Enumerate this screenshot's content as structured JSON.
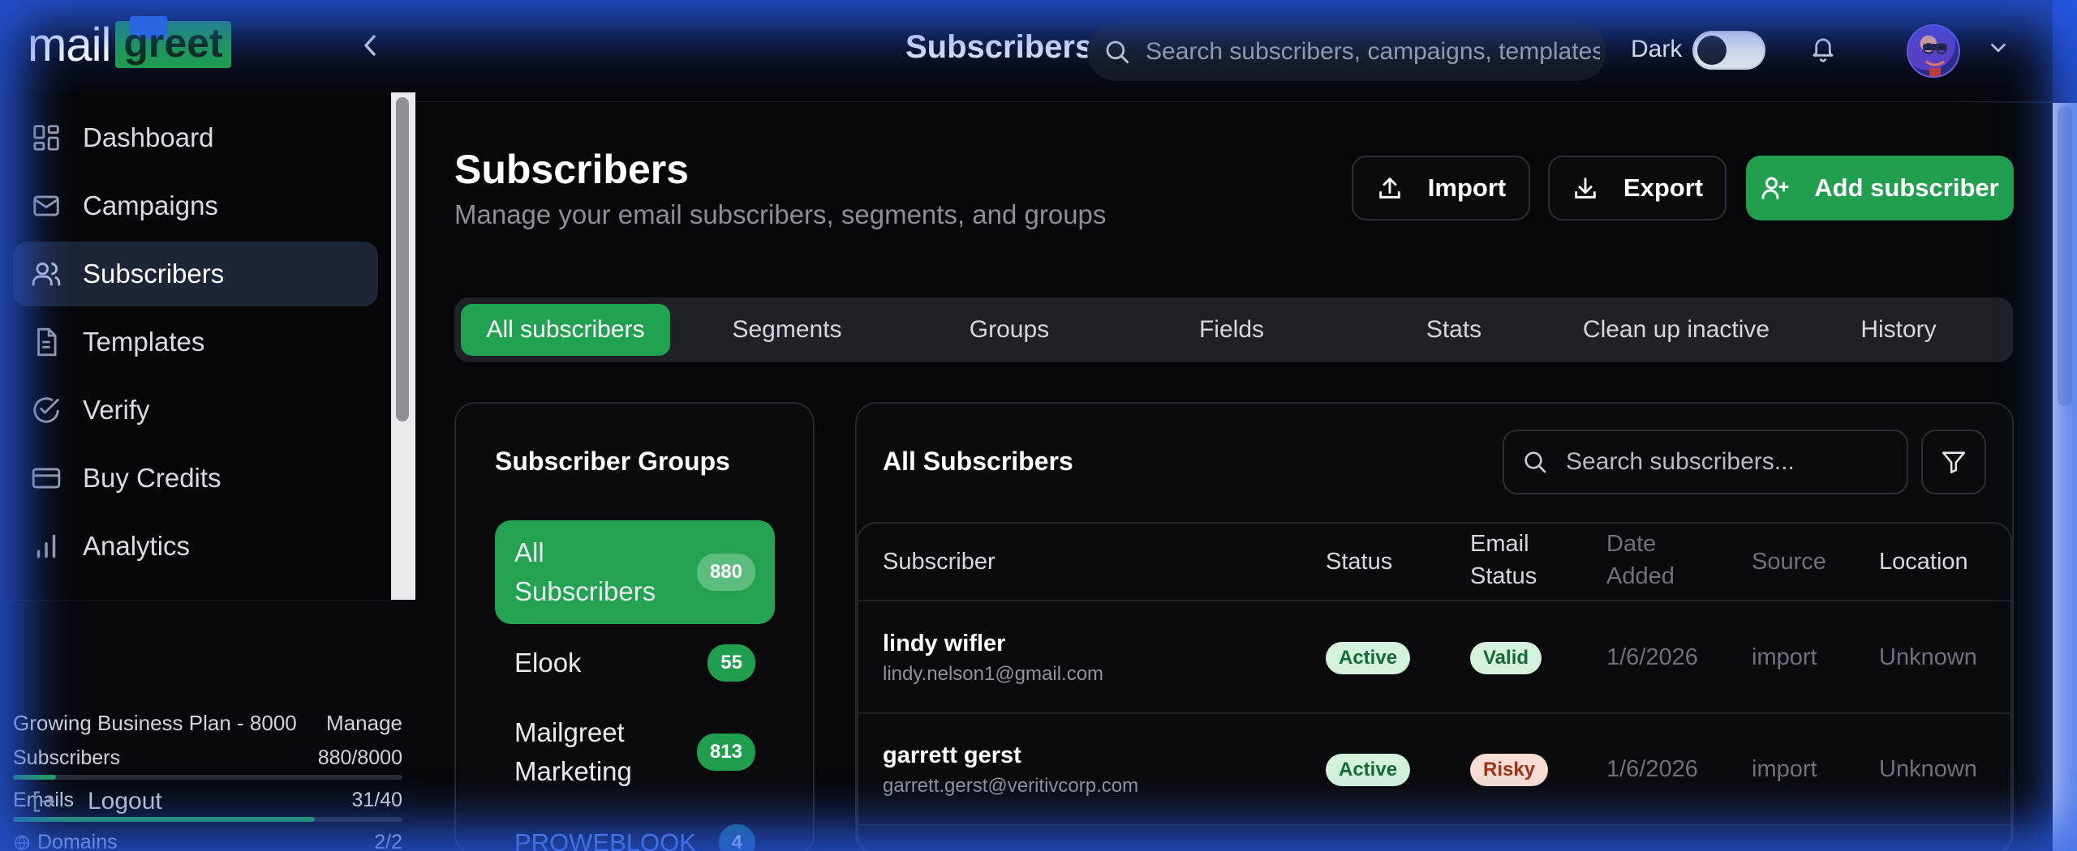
{
  "header": {
    "logo_mail": "mail",
    "logo_greet": "greet",
    "title": "Subscribers",
    "search_placeholder": "Search subscribers, campaigns, templates...",
    "dark_label": "Dark"
  },
  "sidebar": {
    "items": [
      {
        "label": "Dashboard",
        "icon": "dashboard-icon"
      },
      {
        "label": "Campaigns",
        "icon": "mail-icon"
      },
      {
        "label": "Subscribers",
        "icon": "users-icon",
        "active": true
      },
      {
        "label": "Templates",
        "icon": "document-icon"
      },
      {
        "label": "Verify",
        "icon": "check-circle-icon"
      },
      {
        "label": "Buy Credits",
        "icon": "credit-card-icon"
      },
      {
        "label": "Analytics",
        "icon": "bar-chart-icon"
      }
    ],
    "plan": {
      "name": "Growing Business Plan - 8000",
      "manage": "Manage",
      "subscribers_label": "Subscribers",
      "subscribers_value": "880/8000",
      "subscribers_fraction": 0.11,
      "emails_label": "Emails",
      "emails_value": "31/40",
      "emails_fraction": 0.775,
      "domains_label": "Domains",
      "domains_value": "2/2",
      "domains_fraction": 1.0
    },
    "logout": "Logout"
  },
  "page": {
    "title": "Subscribers",
    "subtitle": "Manage your email subscribers, segments, and groups",
    "import": "Import",
    "export": "Export",
    "add": "Add subscriber"
  },
  "tabs": [
    "All subscribers",
    "Segments",
    "Groups",
    "Fields",
    "Stats",
    "Clean up inactive",
    "History"
  ],
  "groups": {
    "title": "Subscriber Groups",
    "items": [
      {
        "name": "All Subscribers",
        "count": "880"
      },
      {
        "name": "Elook",
        "count": "55"
      },
      {
        "name": "Mailgreet Marketing",
        "count": "813"
      },
      {
        "name": "PROWEBLOOK",
        "count": "4"
      }
    ]
  },
  "subscribers": {
    "title": "All Subscribers",
    "search_placeholder": "Search subscribers...",
    "columns": {
      "subscriber": "Subscriber",
      "status": "Status",
      "email_status": "Email Status",
      "date_added": "Date Added",
      "source": "Source",
      "location": "Location"
    },
    "rows": [
      {
        "name": "lindy wifler",
        "email": "lindy.nelson1@gmail.com",
        "status": "Active",
        "email_status": "Valid",
        "date": "1/6/2026",
        "source": "import",
        "location": "Unknown"
      },
      {
        "name": "garrett gerst",
        "email": "garrett.gerst@veritivcorp.com",
        "status": "Active",
        "email_status": "Risky",
        "date": "1/6/2026",
        "source": "import",
        "location": "Unknown"
      }
    ]
  },
  "colors": {
    "accent_green": "#20a04f",
    "frame_blue": "#1d45c9"
  }
}
